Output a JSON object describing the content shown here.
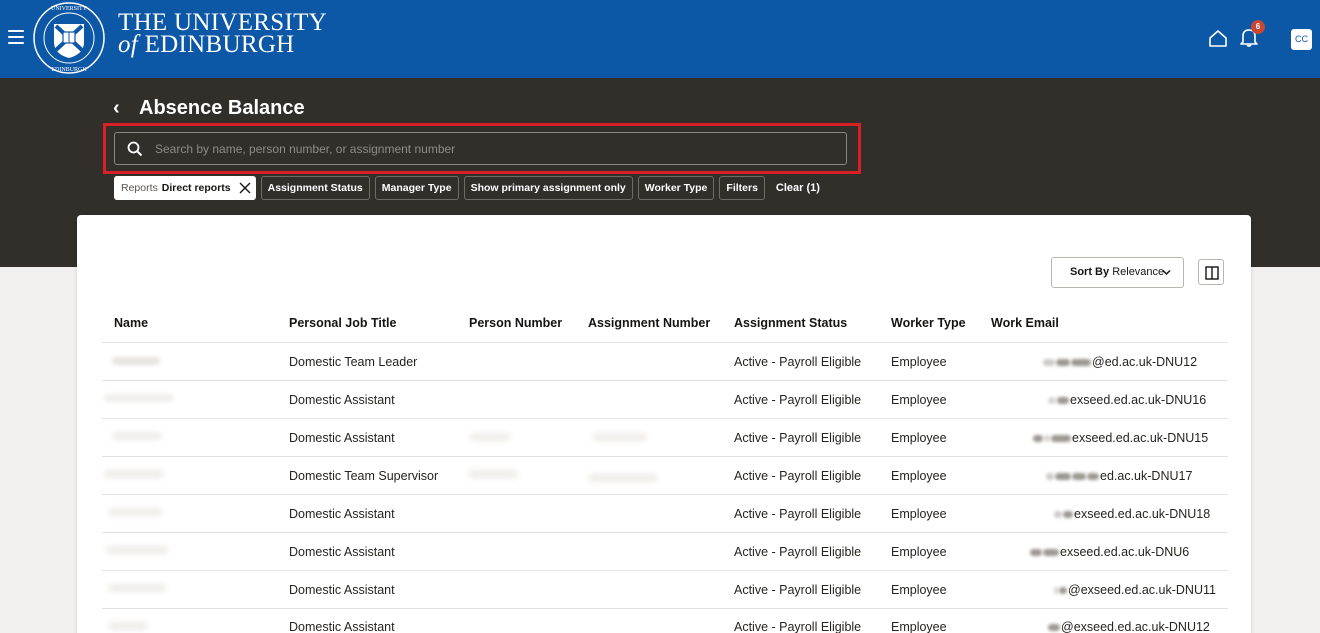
{
  "brand": {
    "line1": "THE UNIVERSITY",
    "line2_of": "of",
    "line2_name": "EDINBURGH",
    "color": "#0d58a6"
  },
  "header": {
    "menu_icon": "hamburger-icon",
    "home_icon": "home-icon",
    "notifications_icon": "bell-icon",
    "notifications_count": "6",
    "avatar_initials": "CC"
  },
  "page": {
    "title": "Absence Balance",
    "back_icon": "chevron-left-icon"
  },
  "search": {
    "placeholder": "Search by name, person number, or assignment number",
    "value": "",
    "highlight_color": "#d72127"
  },
  "filters": {
    "active_chip": {
      "key": "Reports",
      "value": "Direct reports"
    },
    "chips": [
      "Assignment Status",
      "Manager Type",
      "Show primary assignment only",
      "Worker Type",
      "Filters"
    ],
    "clear_label": "Clear (1)"
  },
  "sort": {
    "label": "Sort By",
    "value": "Relevance"
  },
  "table": {
    "columns": [
      "Name",
      "Personal Job Title",
      "Person Number",
      "Assignment Number",
      "Assignment Status",
      "Worker Type",
      "Work Email"
    ],
    "rows": [
      {
        "job_title": "Domestic Team Leader",
        "status": "Active - Payroll Eligible",
        "worker_type": "Employee",
        "email_suffix": "@ed.ac.uk-DNU12"
      },
      {
        "job_title": "Domestic Assistant",
        "status": "Active - Payroll Eligible",
        "worker_type": "Employee",
        "email_suffix": "exseed.ed.ac.uk-DNU16"
      },
      {
        "job_title": "Domestic Assistant",
        "status": "Active - Payroll Eligible",
        "worker_type": "Employee",
        "email_suffix": "exseed.ed.ac.uk-DNU15"
      },
      {
        "job_title": "Domestic Team Supervisor",
        "status": "Active - Payroll Eligible",
        "worker_type": "Employee",
        "email_suffix": "ed.ac.uk-DNU17"
      },
      {
        "job_title": "Domestic Assistant",
        "status": "Active - Payroll Eligible",
        "worker_type": "Employee",
        "email_suffix": "exseed.ed.ac.uk-DNU18"
      },
      {
        "job_title": "Domestic Assistant",
        "status": "Active - Payroll Eligible",
        "worker_type": "Employee",
        "email_suffix": "exseed.ed.ac.uk-DNU6"
      },
      {
        "job_title": "Domestic Assistant",
        "status": "Active - Payroll Eligible",
        "worker_type": "Employee",
        "email_suffix": "@exseed.ed.ac.uk-DNU11"
      },
      {
        "job_title": "Domestic Assistant",
        "status": "Active - Payroll Eligible",
        "worker_type": "Employee",
        "email_suffix": "@exseed.ed.ac.uk-DNU12"
      }
    ]
  }
}
